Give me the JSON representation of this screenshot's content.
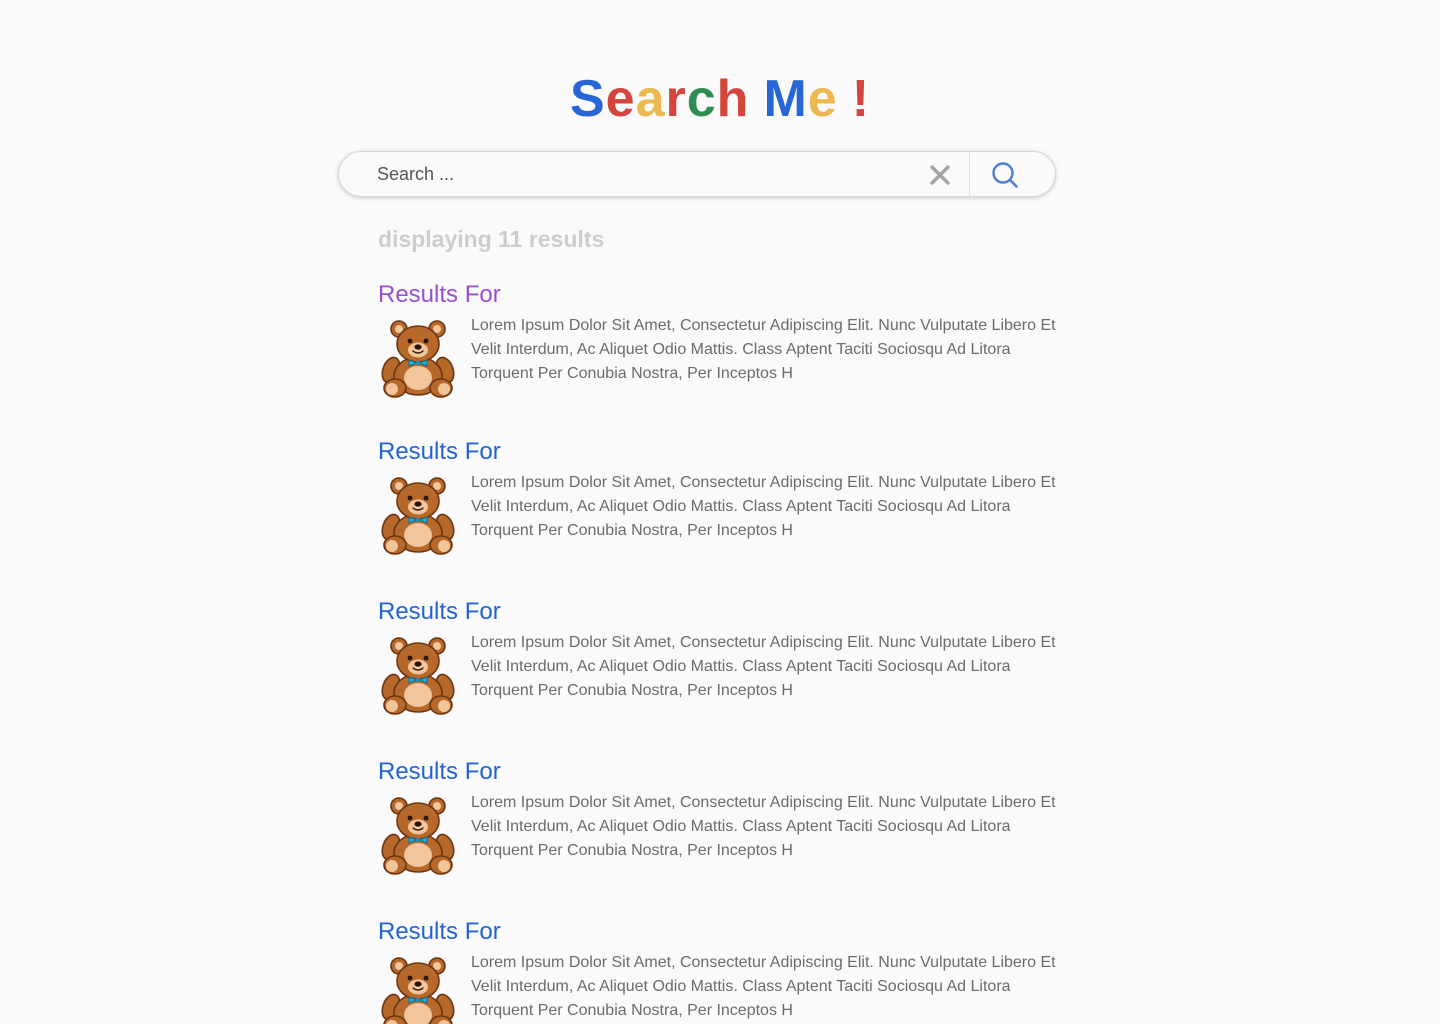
{
  "logo": {
    "letters": [
      {
        "char": "S",
        "color": "#2866d8"
      },
      {
        "char": "e",
        "color": "#d3453d"
      },
      {
        "char": "a",
        "color": "#eab94f"
      },
      {
        "char": "r",
        "color": "#d3453d"
      },
      {
        "char": "c",
        "color": "#2f8c52"
      },
      {
        "char": "h",
        "color": "#d3453d"
      },
      {
        "char": "M",
        "color": "#2866d8"
      },
      {
        "char": "e",
        "color": "#eab94f"
      },
      {
        "char": "!",
        "color": "#d3453d"
      }
    ]
  },
  "search": {
    "placeholder": "Search ...",
    "value": "",
    "clear_icon": "close-icon",
    "search_icon": "search-icon"
  },
  "results_summary": "displaying 11 results",
  "colors": {
    "link": "#2463d6",
    "visited_link": "#9b4fd0",
    "summary": "#cdcdcd",
    "description": "#6b6b6b",
    "accent": "#4a7fd8"
  },
  "results": [
    {
      "title": "Results For",
      "visited": true,
      "thumbnail": "teddy-bear",
      "description": "Lorem Ipsum Dolor Sit Amet, Consectetur Adipiscing Elit. Nunc Vulputate Libero Et Velit Interdum, Ac Aliquet Odio Mattis. Class Aptent Taciti Sociosqu Ad Litora Torquent Per Conubia Nostra, Per Inceptos H"
    },
    {
      "title": "Results For",
      "visited": false,
      "thumbnail": "teddy-bear",
      "description": "Lorem Ipsum Dolor Sit Amet, Consectetur Adipiscing Elit. Nunc Vulputate Libero Et Velit Interdum, Ac Aliquet Odio Mattis. Class Aptent Taciti Sociosqu Ad Litora Torquent Per Conubia Nostra, Per Inceptos H"
    },
    {
      "title": "Results For",
      "visited": false,
      "thumbnail": "teddy-bear",
      "description": "Lorem Ipsum Dolor Sit Amet, Consectetur Adipiscing Elit. Nunc Vulputate Libero Et Velit Interdum, Ac Aliquet Odio Mattis. Class Aptent Taciti Sociosqu Ad Litora Torquent Per Conubia Nostra, Per Inceptos H"
    },
    {
      "title": "Results For",
      "visited": false,
      "thumbnail": "teddy-bear",
      "description": "Lorem Ipsum Dolor Sit Amet, Consectetur Adipiscing Elit. Nunc Vulputate Libero Et Velit Interdum, Ac Aliquet Odio Mattis. Class Aptent Taciti Sociosqu Ad Litora Torquent Per Conubia Nostra, Per Inceptos H"
    },
    {
      "title": "Results For",
      "visited": false,
      "thumbnail": "teddy-bear",
      "description": "Lorem Ipsum Dolor Sit Amet, Consectetur Adipiscing Elit. Nunc Vulputate Libero Et Velit Interdum, Ac Aliquet Odio Mattis. Class Aptent Taciti Sociosqu Ad Litora Torquent Per Conubia Nostra, Per Inceptos H"
    }
  ]
}
